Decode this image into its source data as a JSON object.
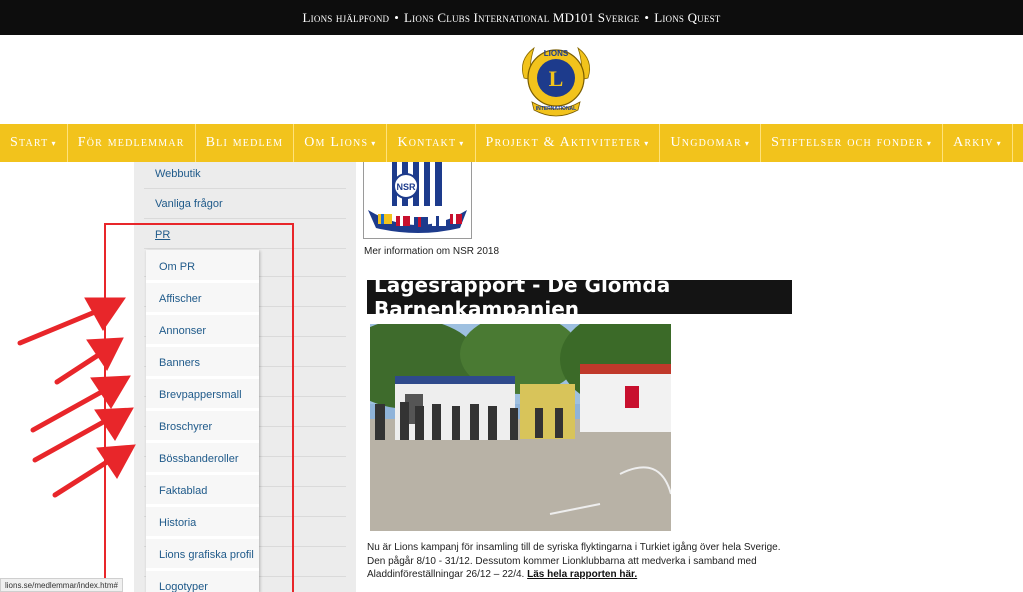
{
  "topbar": {
    "items": [
      "Lions hjälpfond",
      "Lions Clubs International MD101 Sverige",
      "Lions Quest"
    ],
    "separator": "•"
  },
  "logo": {
    "text": "LIONS",
    "letter": "L",
    "ribbon": "INTERNATIONAL"
  },
  "nav": {
    "items": [
      {
        "label": "Start",
        "caret": "▾"
      },
      {
        "label": "För medlemmar",
        "caret": ""
      },
      {
        "label": "Bli medlem",
        "caret": ""
      },
      {
        "label": "Om Lions",
        "caret": "▾"
      },
      {
        "label": "Kontakt",
        "caret": "▾"
      },
      {
        "label": "Projekt & Aktiviteter",
        "caret": "▾"
      },
      {
        "label": "Ungdomar",
        "caret": "▾"
      },
      {
        "label": "Stiftelser och fonder",
        "caret": "▾"
      },
      {
        "label": "Arkiv",
        "caret": "▾"
      }
    ],
    "flag_icon": "uk-flag-icon"
  },
  "sidebar": {
    "items": [
      "Webbutik",
      "Vanliga frågor",
      "PR"
    ],
    "submenu": [
      "Om PR",
      "Affischer",
      "Annonser",
      "Banners",
      "Brevpappersmall",
      "Broschyrer",
      "Bössbanderoller",
      "Faktablad",
      "Historia",
      "Lions grafiska profil",
      "Logotyper"
    ]
  },
  "content": {
    "nsr_logo_text": "NSR",
    "nsr_caption": "Mer information om NSR 2018",
    "headline": "Lägesrapport - De Glömda Barnenkampanjen",
    "body": "Nu är Lions kampanj för insamling till de syriska flyktingarna i Turkiet igång över hela Sverige. Den pågår 8/10 - 31/12. Dessutom kommer Lionklubbarna att medverka i samband med Aladdinföreställningar 26/12 – 22/4.",
    "read_more": "Läs hela rapporten här."
  },
  "status_url": "lions.se/medlemmar/index.htm#",
  "colors": {
    "nav_yellow": "#f2c31c",
    "topbar": "#0d0d0d",
    "link": "#1f5a8a",
    "annotation_red": "#e8262a"
  }
}
